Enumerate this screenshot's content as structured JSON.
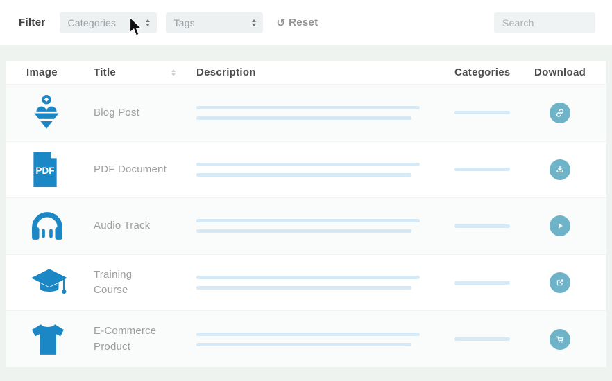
{
  "filter_bar": {
    "label": "Filter",
    "categories_select": "Categories",
    "tags_select": "Tags",
    "reset_label": "Reset",
    "search_placeholder": "Search"
  },
  "table": {
    "headers": {
      "image": "Image",
      "title": "Title",
      "description": "Description",
      "categories": "Categories",
      "download": "Download"
    },
    "rows": [
      {
        "title": "Blog Post",
        "image_icon": "content-marketing-icon",
        "download_icon": "link-icon"
      },
      {
        "title": "PDF Document",
        "image_icon": "pdf-file-icon",
        "download_icon": "download-icon"
      },
      {
        "title": "Audio Track",
        "image_icon": "headphones-icon",
        "download_icon": "play-icon"
      },
      {
        "title": "Training Course",
        "image_icon": "graduation-cap-icon",
        "download_icon": "external-link-icon"
      },
      {
        "title": "E-Commerce Product",
        "image_icon": "tshirt-icon",
        "download_icon": "shopping-cart-icon"
      }
    ],
    "pdf_icon_text": "PDF"
  },
  "colors": {
    "accent_blue": "#1b87c5",
    "button_teal": "#6fb3c8",
    "placeholder_bar": "#d5e9f6",
    "page_background": "#eef3f0"
  }
}
